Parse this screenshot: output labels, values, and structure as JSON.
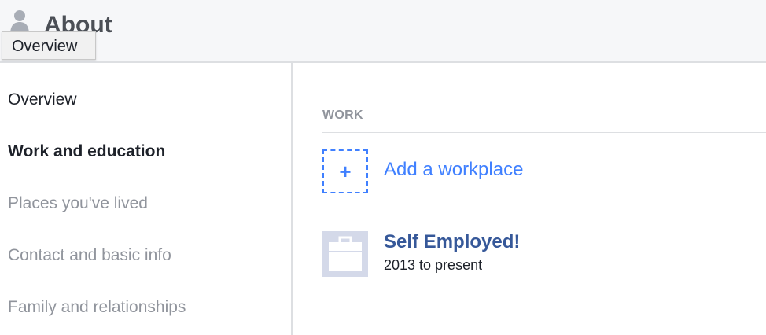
{
  "header": {
    "title": "About",
    "tooltip": "Overview"
  },
  "sidebar": {
    "items": [
      {
        "label": "Overview"
      },
      {
        "label": "Work and education"
      },
      {
        "label": "Places you've lived"
      },
      {
        "label": "Contact and basic info"
      },
      {
        "label": "Family and relationships"
      }
    ]
  },
  "main": {
    "section_label": "WORK",
    "add_label": "Add a workplace",
    "add_icon": "+",
    "workplaces": [
      {
        "name": "Self Employed!",
        "dates": "2013 to present"
      }
    ]
  },
  "colors": {
    "link": "#4080ff",
    "workplace_link": "#365899",
    "muted": "#90949c",
    "text": "#1d2129"
  }
}
